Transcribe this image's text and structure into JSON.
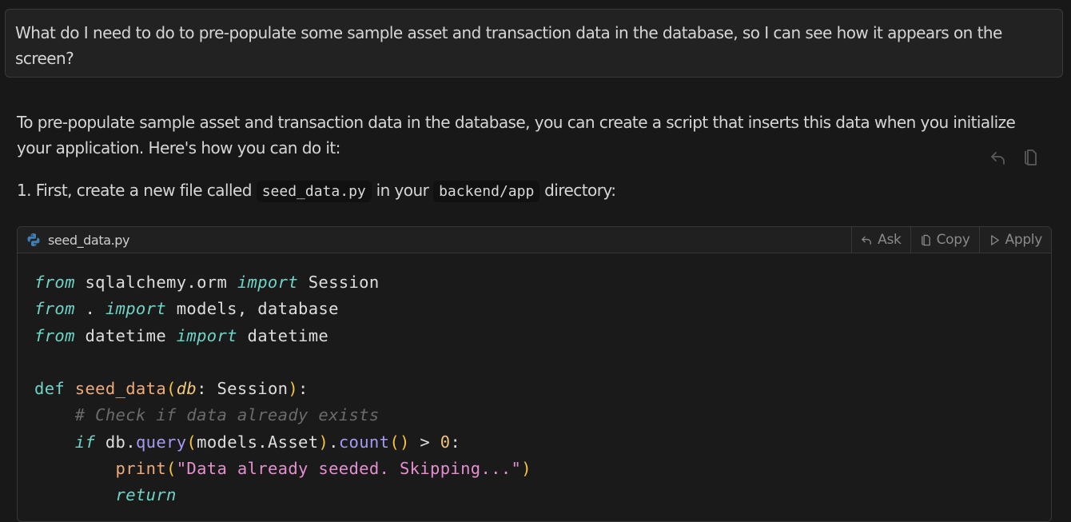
{
  "user_message": {
    "text": "What do I need to do to pre-populate some sample asset and transaction data in the database, so I can see how it appears on the screen?"
  },
  "assistant": {
    "intro": "To pre-populate sample asset and transaction data in the database, you can create a script that inserts this data when you initialize your application. Here's how you can do it:",
    "actions": [
      {
        "name": "reply",
        "icon": "reply-arrow-icon"
      },
      {
        "name": "copy",
        "icon": "copy-icon"
      }
    ],
    "step1": {
      "prefix": "1. First, create a new file called",
      "filename": "seed_data.py",
      "middle": "in your",
      "directory": "backend/app",
      "suffix": "directory:"
    }
  },
  "code_block": {
    "filename": "seed_data.py",
    "language_icon": "python-icon",
    "buttons": {
      "ask": "Ask",
      "copy": "Copy",
      "apply": "Apply"
    },
    "lines": [
      "from sqlalchemy.orm import Session",
      "from . import models, database",
      "from datetime import datetime",
      "",
      "def seed_data(db: Session):",
      "    # Check if data already exists",
      "    if db.query(models.Asset).count() > 0:",
      "        print(\"Data already seeded. Skipping...\")",
      "        return"
    ],
    "tokens": {
      "from": "from",
      "import": "import",
      "l1_mod": " sqlalchemy.orm ",
      "l1_name": " Session",
      "l2_mod": " . ",
      "l2_name": " models, database",
      "l3_mod": " datetime ",
      "l3_name": " datetime",
      "def": "def",
      "fn_name": "seed_data",
      "param": "db",
      "param_type": ": Session",
      "comment": "# Check if data already exists",
      "if": "if",
      "db": " db.",
      "query": "query",
      "models_asset": "models.Asset",
      "count": "count",
      "gt": " > ",
      "zero": "0",
      "colon": ":",
      "print": "print",
      "string": "\"Data already seeded. Skipping...\"",
      "return": "return"
    }
  }
}
